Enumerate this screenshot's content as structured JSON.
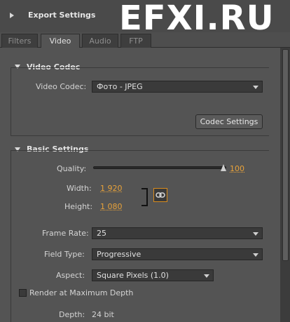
{
  "header": {
    "title": "Export Settings"
  },
  "watermark": "EFXI.RU",
  "tabs": [
    {
      "label": "Filters"
    },
    {
      "label": "Video"
    },
    {
      "label": "Audio"
    },
    {
      "label": "FTP"
    }
  ],
  "active_tab": "Video",
  "video_codec": {
    "section_title": "Video Codec",
    "codec_label": "Video Codec:",
    "codec_value": "Фото - JPEG",
    "codec_settings_button": "Codec Settings"
  },
  "basic_settings": {
    "section_title": "Basic Settings",
    "quality_label": "Quality:",
    "quality_value": "100",
    "quality_level": 1.0,
    "width_label": "Width:",
    "width_value": "1 920",
    "height_label": "Height:",
    "height_value": "1 080",
    "frame_rate_label": "Frame Rate:",
    "frame_rate_value": "25",
    "field_type_label": "Field Type:",
    "field_type_value": "Progressive",
    "aspect_label": "Aspect:",
    "aspect_value": "Square Pixels (1.0)",
    "render_max_depth_label": "Render at Maximum Depth",
    "render_max_depth_checked": false,
    "depth_label": "Depth:",
    "depth_value": "24 bit"
  },
  "colors": {
    "accent_value": "#e8a23a",
    "link_border": "#d98c1e",
    "panel_bg": "#545454"
  }
}
